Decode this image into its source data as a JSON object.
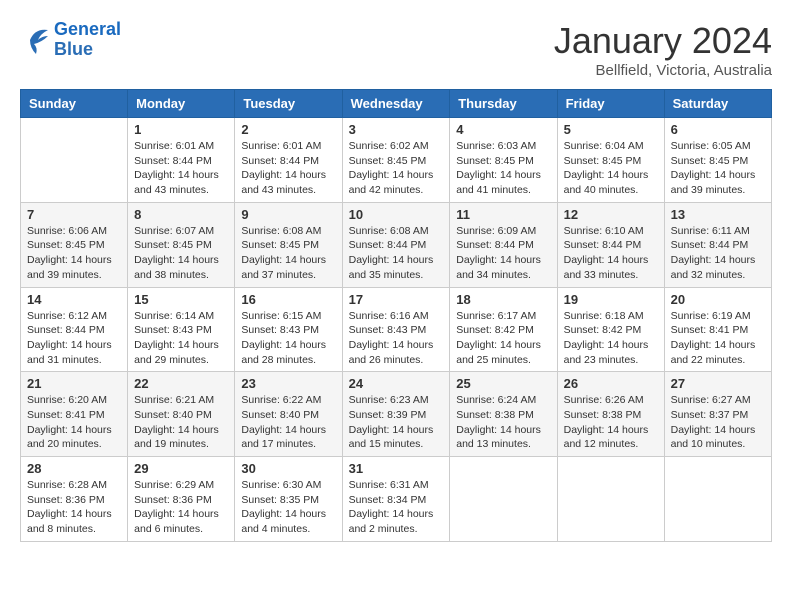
{
  "header": {
    "logo_line1": "General",
    "logo_line2": "Blue",
    "month_title": "January 2024",
    "location": "Bellfield, Victoria, Australia"
  },
  "weekdays": [
    "Sunday",
    "Monday",
    "Tuesday",
    "Wednesday",
    "Thursday",
    "Friday",
    "Saturday"
  ],
  "weeks": [
    [
      {
        "day": "",
        "info": ""
      },
      {
        "day": "1",
        "info": "Sunrise: 6:01 AM\nSunset: 8:44 PM\nDaylight: 14 hours\nand 43 minutes."
      },
      {
        "day": "2",
        "info": "Sunrise: 6:01 AM\nSunset: 8:44 PM\nDaylight: 14 hours\nand 43 minutes."
      },
      {
        "day": "3",
        "info": "Sunrise: 6:02 AM\nSunset: 8:45 PM\nDaylight: 14 hours\nand 42 minutes."
      },
      {
        "day": "4",
        "info": "Sunrise: 6:03 AM\nSunset: 8:45 PM\nDaylight: 14 hours\nand 41 minutes."
      },
      {
        "day": "5",
        "info": "Sunrise: 6:04 AM\nSunset: 8:45 PM\nDaylight: 14 hours\nand 40 minutes."
      },
      {
        "day": "6",
        "info": "Sunrise: 6:05 AM\nSunset: 8:45 PM\nDaylight: 14 hours\nand 39 minutes."
      }
    ],
    [
      {
        "day": "7",
        "info": "Sunrise: 6:06 AM\nSunset: 8:45 PM\nDaylight: 14 hours\nand 39 minutes."
      },
      {
        "day": "8",
        "info": "Sunrise: 6:07 AM\nSunset: 8:45 PM\nDaylight: 14 hours\nand 38 minutes."
      },
      {
        "day": "9",
        "info": "Sunrise: 6:08 AM\nSunset: 8:45 PM\nDaylight: 14 hours\nand 37 minutes."
      },
      {
        "day": "10",
        "info": "Sunrise: 6:08 AM\nSunset: 8:44 PM\nDaylight: 14 hours\nand 35 minutes."
      },
      {
        "day": "11",
        "info": "Sunrise: 6:09 AM\nSunset: 8:44 PM\nDaylight: 14 hours\nand 34 minutes."
      },
      {
        "day": "12",
        "info": "Sunrise: 6:10 AM\nSunset: 8:44 PM\nDaylight: 14 hours\nand 33 minutes."
      },
      {
        "day": "13",
        "info": "Sunrise: 6:11 AM\nSunset: 8:44 PM\nDaylight: 14 hours\nand 32 minutes."
      }
    ],
    [
      {
        "day": "14",
        "info": "Sunrise: 6:12 AM\nSunset: 8:44 PM\nDaylight: 14 hours\nand 31 minutes."
      },
      {
        "day": "15",
        "info": "Sunrise: 6:14 AM\nSunset: 8:43 PM\nDaylight: 14 hours\nand 29 minutes."
      },
      {
        "day": "16",
        "info": "Sunrise: 6:15 AM\nSunset: 8:43 PM\nDaylight: 14 hours\nand 28 minutes."
      },
      {
        "day": "17",
        "info": "Sunrise: 6:16 AM\nSunset: 8:43 PM\nDaylight: 14 hours\nand 26 minutes."
      },
      {
        "day": "18",
        "info": "Sunrise: 6:17 AM\nSunset: 8:42 PM\nDaylight: 14 hours\nand 25 minutes."
      },
      {
        "day": "19",
        "info": "Sunrise: 6:18 AM\nSunset: 8:42 PM\nDaylight: 14 hours\nand 23 minutes."
      },
      {
        "day": "20",
        "info": "Sunrise: 6:19 AM\nSunset: 8:41 PM\nDaylight: 14 hours\nand 22 minutes."
      }
    ],
    [
      {
        "day": "21",
        "info": "Sunrise: 6:20 AM\nSunset: 8:41 PM\nDaylight: 14 hours\nand 20 minutes."
      },
      {
        "day": "22",
        "info": "Sunrise: 6:21 AM\nSunset: 8:40 PM\nDaylight: 14 hours\nand 19 minutes."
      },
      {
        "day": "23",
        "info": "Sunrise: 6:22 AM\nSunset: 8:40 PM\nDaylight: 14 hours\nand 17 minutes."
      },
      {
        "day": "24",
        "info": "Sunrise: 6:23 AM\nSunset: 8:39 PM\nDaylight: 14 hours\nand 15 minutes."
      },
      {
        "day": "25",
        "info": "Sunrise: 6:24 AM\nSunset: 8:38 PM\nDaylight: 14 hours\nand 13 minutes."
      },
      {
        "day": "26",
        "info": "Sunrise: 6:26 AM\nSunset: 8:38 PM\nDaylight: 14 hours\nand 12 minutes."
      },
      {
        "day": "27",
        "info": "Sunrise: 6:27 AM\nSunset: 8:37 PM\nDaylight: 14 hours\nand 10 minutes."
      }
    ],
    [
      {
        "day": "28",
        "info": "Sunrise: 6:28 AM\nSunset: 8:36 PM\nDaylight: 14 hours\nand 8 minutes."
      },
      {
        "day": "29",
        "info": "Sunrise: 6:29 AM\nSunset: 8:36 PM\nDaylight: 14 hours\nand 6 minutes."
      },
      {
        "day": "30",
        "info": "Sunrise: 6:30 AM\nSunset: 8:35 PM\nDaylight: 14 hours\nand 4 minutes."
      },
      {
        "day": "31",
        "info": "Sunrise: 6:31 AM\nSunset: 8:34 PM\nDaylight: 14 hours\nand 2 minutes."
      },
      {
        "day": "",
        "info": ""
      },
      {
        "day": "",
        "info": ""
      },
      {
        "day": "",
        "info": ""
      }
    ]
  ]
}
